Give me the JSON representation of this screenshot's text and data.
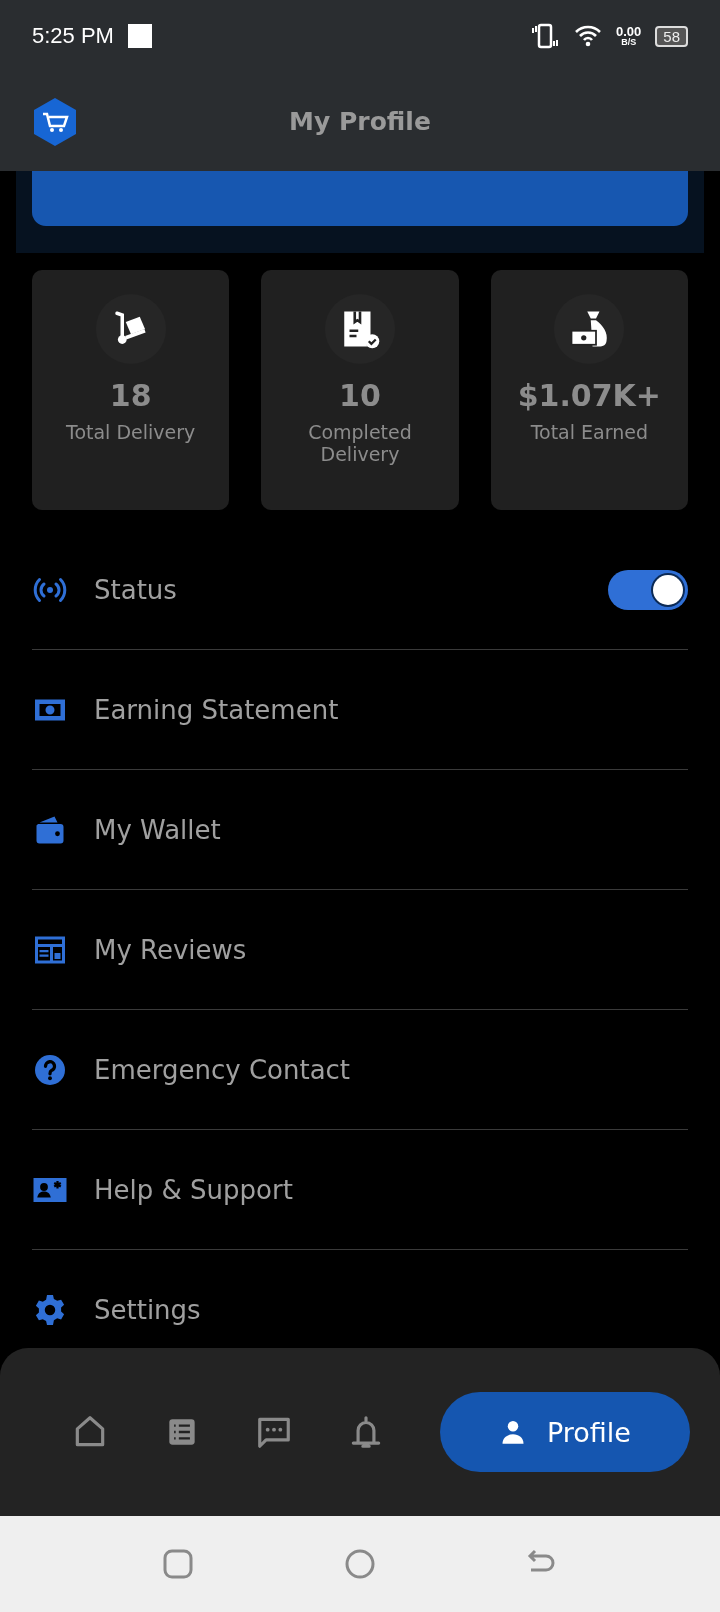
{
  "status_bar": {
    "time": "5:25 PM",
    "speed_value": "0.00",
    "speed_unit": "B/S",
    "battery": "58"
  },
  "app_bar": {
    "title": "My Profile"
  },
  "stats": [
    {
      "value": "18",
      "label": "Total Delivery"
    },
    {
      "value": "10",
      "label": "Completed Delivery"
    },
    {
      "value": "$1.07K+",
      "label": "Total Earned"
    }
  ],
  "menu": [
    {
      "kind": "toggle",
      "label": "Status",
      "on": true
    },
    {
      "kind": "link",
      "label": "Earning Statement"
    },
    {
      "kind": "link",
      "label": "My Wallet"
    },
    {
      "kind": "link",
      "label": "My Reviews"
    },
    {
      "kind": "link",
      "label": "Emergency Contact"
    },
    {
      "kind": "link",
      "label": "Help & Support"
    },
    {
      "kind": "link",
      "label": "Settings"
    }
  ],
  "bottom_nav": [
    {
      "selected": false
    },
    {
      "selected": false
    },
    {
      "selected": false
    },
    {
      "selected": false
    },
    {
      "selected": true,
      "label": "Profile"
    }
  ]
}
